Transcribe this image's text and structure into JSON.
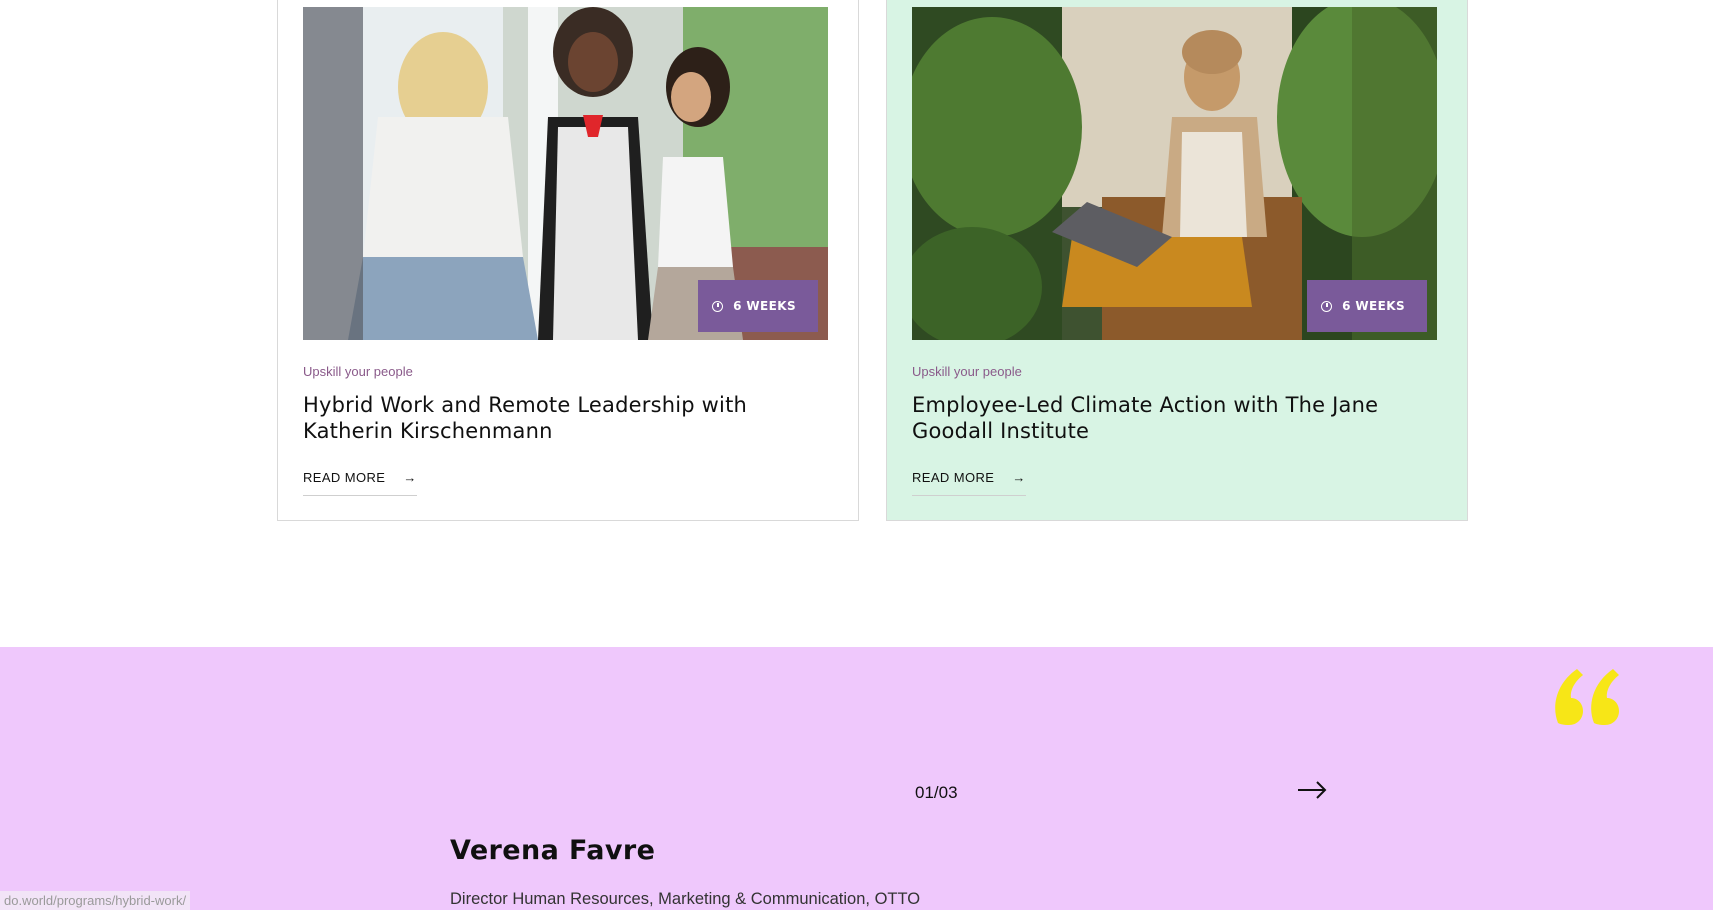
{
  "programs": [
    {
      "category": "Upskill your people",
      "title": "Hybrid Work and Remote Leadership with Katherin Kirschenmann",
      "duration": "6 WEEKS",
      "read_more": "READ MORE",
      "arrow": "→"
    },
    {
      "category": "Upskill your people",
      "title": "Employee-Led Climate Action with The Jane Goodall Institute",
      "duration": "6 WEEKS",
      "read_more": "READ MORE",
      "arrow": "→"
    }
  ],
  "testimonial": {
    "counter": "01/03",
    "name": "Verena Favre",
    "role": "Director Human Resources, Marketing & Communication, OTTO",
    "quote_color": "#f7e617",
    "background": "#efc8fc"
  },
  "status_bar": {
    "url": "do.world/programs/hybrid-work/"
  }
}
